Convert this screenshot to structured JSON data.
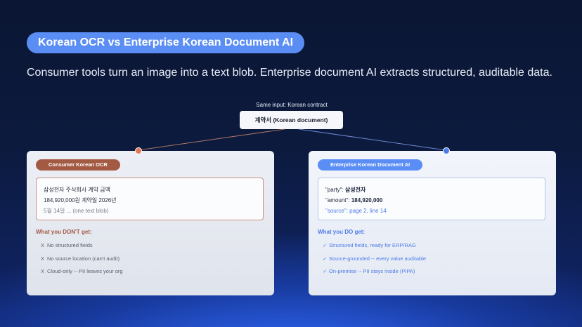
{
  "title": "Korean OCR vs Enterprise Korean Document AI",
  "subtitle": "Consumer tools turn an image into a text blob. Enterprise document AI extracts structured, auditable data.",
  "input": {
    "caption": "Same input: Korean contract",
    "label": "계약서 (Korean document)"
  },
  "consumer": {
    "tag": "Consumer Korean OCR",
    "blob_lines": [
      "삼성전자 주식회사 계약 금액",
      "184,920,000원 계약일 2026년",
      "5월 14일 ... (one text blob)"
    ],
    "heading": "What you DON'T get:",
    "mark": "X",
    "items": [
      "No structured fields",
      "No source location (can't audit)",
      "Cloud-only -- PII leaves your org"
    ],
    "accent_color": "#a35a43"
  },
  "enterprise": {
    "tag": "Enterprise Korean Document AI",
    "fields": [
      {
        "key": "\"party\":",
        "value": "삼성전자"
      },
      {
        "key": "\"amount\":",
        "value": "184,920,000"
      }
    ],
    "source_key": "\"source\":",
    "source_value": "page 2, line 14",
    "heading": "What you DO get:",
    "mark": "✓",
    "items": [
      "Structured fields, ready for ERP/RAG",
      "Source-grounded -- every value auditable",
      "On-premise -- PII stays inside (PIPA)"
    ],
    "accent_color": "#5b8ef5"
  }
}
